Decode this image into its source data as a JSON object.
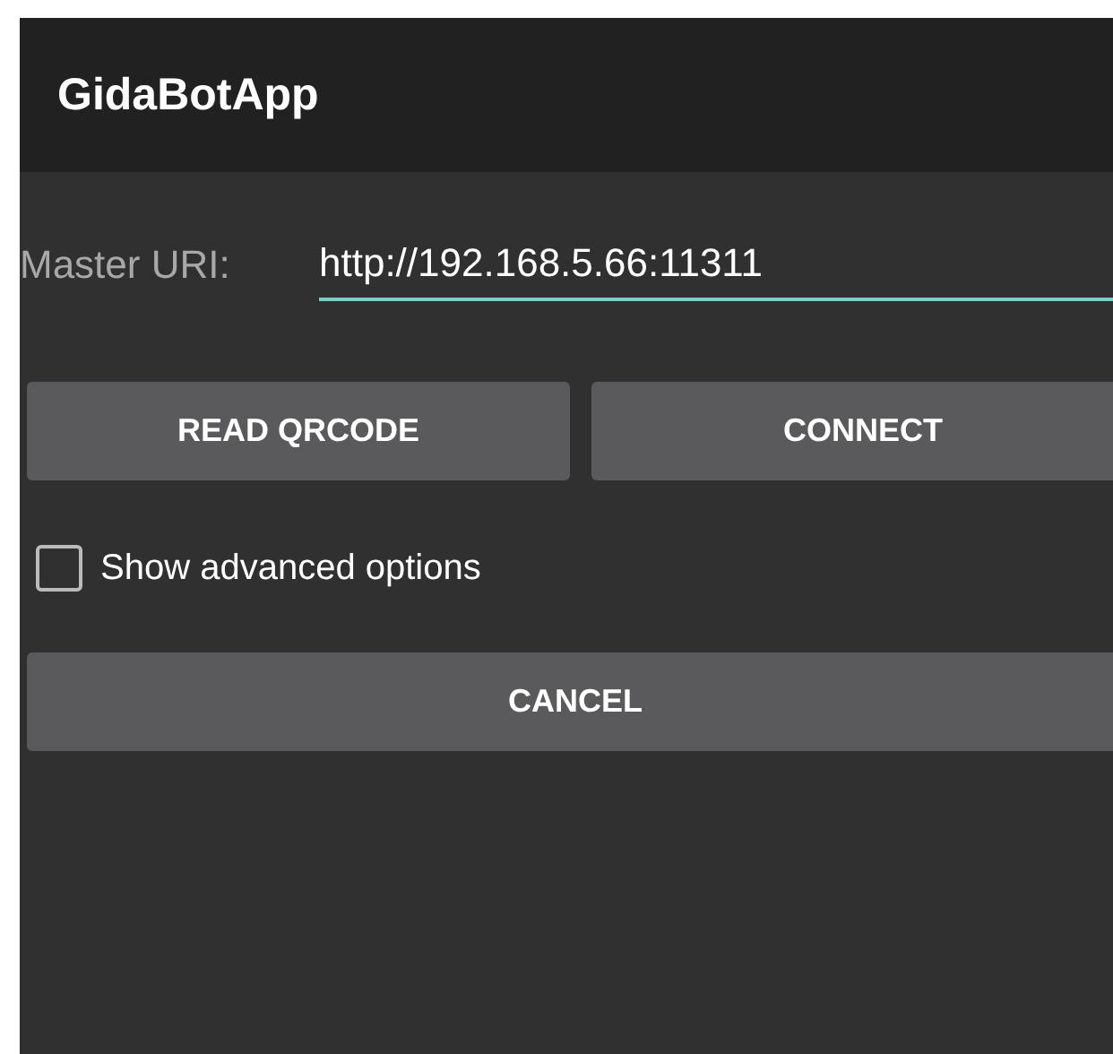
{
  "app_bar": {
    "title": "GidaBotApp"
  },
  "master_uri": {
    "label": "Master URI:",
    "value": "http://192.168.5.66:11311"
  },
  "buttons": [
    {
      "label": "READ QRCODE"
    },
    {
      "label": "CONNECT"
    }
  ],
  "advanced_options": {
    "label": "Show advanced options",
    "checked": false
  },
  "cancel_button": {
    "label": "CANCEL"
  }
}
